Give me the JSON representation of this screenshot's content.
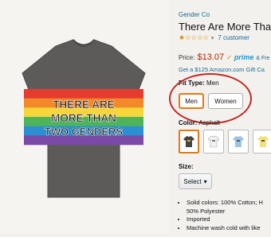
{
  "product": {
    "shirt_text_lines": [
      "THERE ARE",
      "MORE THAN",
      "TWO GENDERS"
    ],
    "shirt_color": "#5d5b5a",
    "stripe_colors": [
      "#e53c2f",
      "#f28a2a",
      "#f6d63a",
      "#4db45b",
      "#2c8fd1",
      "#7a4aa6"
    ]
  },
  "details": {
    "brand": "Gender Co",
    "title": "There Are More Tha",
    "rating": {
      "stars": "★☆☆☆☆",
      "reviews": "7 customer"
    },
    "price": {
      "label": "Price:",
      "value": "$13.07",
      "prime": "prime",
      "free": "& Fre"
    },
    "gift": "Get a $125 Amazon.com Gift Ca",
    "fit": {
      "label": "Fit Type:",
      "value": "Men",
      "options": [
        "Men",
        "Women"
      ]
    },
    "color": {
      "label": "Color:",
      "value": "Asphalt"
    },
    "size": {
      "label": "Size:",
      "select": "Select"
    },
    "bullets": [
      "Solid colors: 100% Cotton; H",
      "50% Polyester",
      "Imported",
      "Machine wash cold with like"
    ]
  },
  "colors": {
    "accent": "#e47911",
    "link": "#1a6a8f",
    "price": "#b12704",
    "annotation": "#c12a23"
  }
}
